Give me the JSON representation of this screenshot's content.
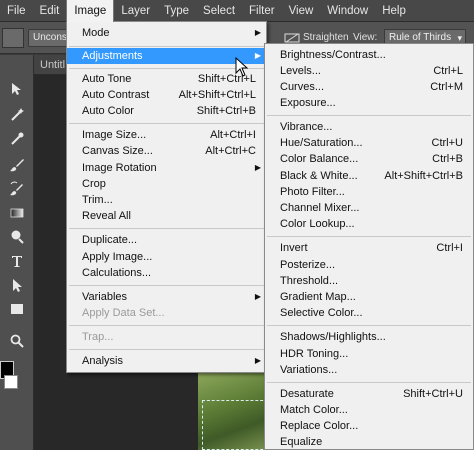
{
  "menubar": {
    "items": [
      "File",
      "Edit",
      "Image",
      "Layer",
      "Type",
      "Select",
      "Filter",
      "View",
      "Window",
      "Help"
    ],
    "active": "Image"
  },
  "options_bar": {
    "unconstrained_label": "Unconst",
    "straighten_label": "Straighten",
    "view_label": "View:",
    "view_value": "Rule of Thirds"
  },
  "document": {
    "tab_title": "Untitl"
  },
  "image_menu": {
    "mode": "Mode",
    "adjustments": "Adjustments",
    "auto_tone": {
      "label": "Auto Tone",
      "shortcut": "Shift+Ctrl+L"
    },
    "auto_contrast": {
      "label": "Auto Contrast",
      "shortcut": "Alt+Shift+Ctrl+L"
    },
    "auto_color": {
      "label": "Auto Color",
      "shortcut": "Shift+Ctrl+B"
    },
    "image_size": {
      "label": "Image Size...",
      "shortcut": "Alt+Ctrl+I"
    },
    "canvas_size": {
      "label": "Canvas Size...",
      "shortcut": "Alt+Ctrl+C"
    },
    "image_rotation": "Image Rotation",
    "crop": "Crop",
    "trim": "Trim...",
    "reveal_all": "Reveal All",
    "duplicate": "Duplicate...",
    "apply_image": "Apply Image...",
    "calculations": "Calculations...",
    "variables": "Variables",
    "apply_data_set": "Apply Data Set...",
    "trap": "Trap...",
    "analysis": "Analysis"
  },
  "adjustments_menu": {
    "brightness_contrast": {
      "label": "Brightness/Contrast...",
      "shortcut": ""
    },
    "levels": {
      "label": "Levels...",
      "shortcut": "Ctrl+L"
    },
    "curves": {
      "label": "Curves...",
      "shortcut": "Ctrl+M"
    },
    "exposure": {
      "label": "Exposure...",
      "shortcut": ""
    },
    "vibrance": {
      "label": "Vibrance...",
      "shortcut": ""
    },
    "hue_saturation": {
      "label": "Hue/Saturation...",
      "shortcut": "Ctrl+U"
    },
    "color_balance": {
      "label": "Color Balance...",
      "shortcut": "Ctrl+B"
    },
    "black_white": {
      "label": "Black & White...",
      "shortcut": "Alt+Shift+Ctrl+B"
    },
    "photo_filter": {
      "label": "Photo Filter...",
      "shortcut": ""
    },
    "channel_mixer": {
      "label": "Channel Mixer...",
      "shortcut": ""
    },
    "color_lookup": {
      "label": "Color Lookup...",
      "shortcut": ""
    },
    "invert": {
      "label": "Invert",
      "shortcut": "Ctrl+I"
    },
    "posterize": {
      "label": "Posterize...",
      "shortcut": ""
    },
    "threshold": {
      "label": "Threshold...",
      "shortcut": ""
    },
    "gradient_map": {
      "label": "Gradient Map...",
      "shortcut": ""
    },
    "selective_color": {
      "label": "Selective Color...",
      "shortcut": ""
    },
    "shadows_highlights": {
      "label": "Shadows/Highlights...",
      "shortcut": ""
    },
    "hdr_toning": {
      "label": "HDR Toning...",
      "shortcut": ""
    },
    "variations": {
      "label": "Variations...",
      "shortcut": ""
    },
    "desaturate": {
      "label": "Desaturate",
      "shortcut": "Shift+Ctrl+U"
    },
    "match_color": {
      "label": "Match Color...",
      "shortcut": ""
    },
    "replace_color": {
      "label": "Replace Color...",
      "shortcut": ""
    },
    "equalize": {
      "label": "Equalize",
      "shortcut": ""
    }
  },
  "colors": {
    "menu_bg": "#f0f0f0",
    "highlight": "#3399ff",
    "chrome_dark": "#484848",
    "disabled_text": "#9a9a9a"
  }
}
